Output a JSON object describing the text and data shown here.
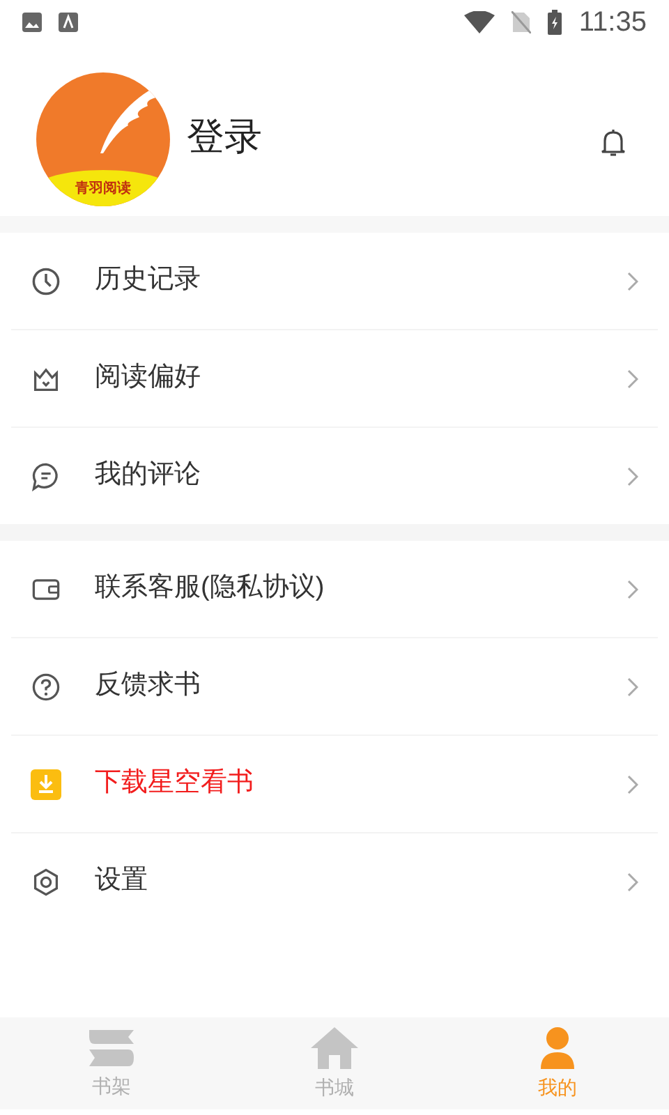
{
  "status_bar": {
    "time": "11:35"
  },
  "profile": {
    "logo_text": "青羽阅读",
    "login": "登录"
  },
  "menu_groups": [
    {
      "items": [
        {
          "label": "历史记录",
          "kind": "normal"
        },
        {
          "label": "阅读偏好",
          "kind": "normal"
        },
        {
          "label": "我的评论",
          "kind": "normal"
        }
      ]
    },
    {
      "items": [
        {
          "label": "联系客服(隐私协议)",
          "kind": "normal"
        },
        {
          "label": "反馈求书",
          "kind": "normal"
        },
        {
          "label": "下载星空看书",
          "kind": "promo"
        },
        {
          "label": "设置",
          "kind": "normal"
        }
      ]
    }
  ],
  "tab_bar": [
    {
      "label": "书架",
      "selected": false
    },
    {
      "label": "书城",
      "selected": false
    },
    {
      "label": "我的",
      "selected": true
    }
  ]
}
